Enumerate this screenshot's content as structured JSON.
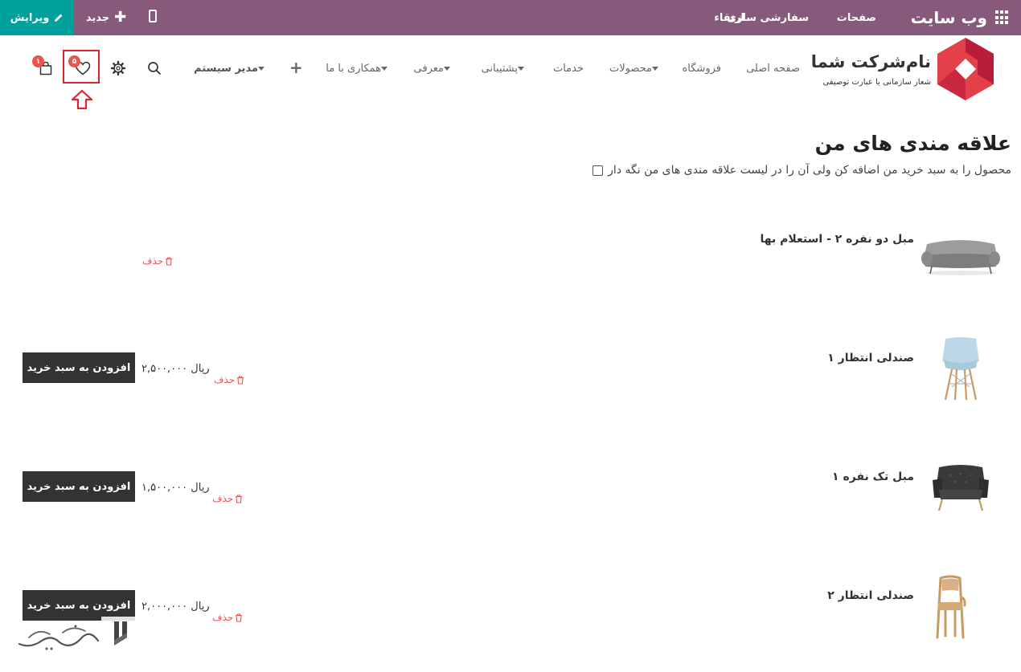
{
  "topbar": {
    "brand": "وب سایت",
    "menu_pages": "صفحات",
    "menu_customize": "سفارشی سازی",
    "menu_upgrade": "ارتقاء",
    "new_label": "جدید",
    "edit_label": "ویرایش",
    "color": "#875a7b",
    "edit_color": "#00a09d"
  },
  "logo": {
    "name": "نام‌شرکت شما",
    "tagline": "شعار سازمانی یا عبارت توصیفی"
  },
  "nav": {
    "home": "صفحه اصلی",
    "shop": "فروشگاه",
    "products": "محصولات",
    "services": "خدمات",
    "support": "پشتیبانی",
    "intro": "معرفی",
    "partner": "همکاری با ما",
    "admin": "مدیر سیستم",
    "wishlist_count": "۵",
    "cart_count": "۱",
    "icons": [
      "plus-icon",
      "search-icon",
      "gear-icon",
      "heart-icon",
      "cart-icon"
    ]
  },
  "wishlist": {
    "title": "علاقه مندی های من",
    "keep_label": "محصول را به سبد خرید من اضافه کن ولی آن را در لیست علاقه مندی های من نگه دار",
    "keep_checked": false,
    "remove_label": "حذف",
    "add_label": "افزودن به سبد خرید",
    "items": [
      {
        "name": "مبل دو نفره ۲ - استعلام بها",
        "price": ""
      },
      {
        "name": "صندلی انتظار ۱",
        "price": "۲,۵۰۰,۰۰۰ ریال"
      },
      {
        "name": "مبل تک نفره ۱",
        "price": "۱,۵۰۰,۰۰۰ ریال"
      },
      {
        "name": "صندلی انتظار ۲",
        "price": "۲,۰۰۰,۰۰۰ ریال"
      }
    ]
  },
  "colors": {
    "accent_red": "#e9544e",
    "highlight_border": "#e0242b",
    "button_dark": "#333333"
  }
}
